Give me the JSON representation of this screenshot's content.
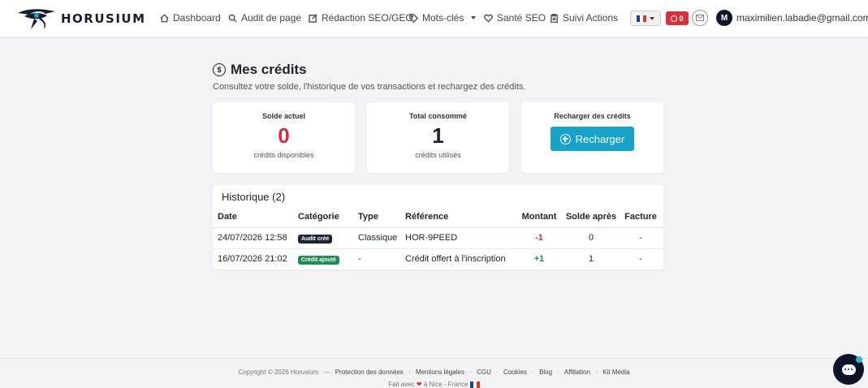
{
  "brand": {
    "name": "HORUSIUM",
    "logo_icon": "horus-eye-logo"
  },
  "nav": {
    "items": [
      {
        "label": "Dashboard",
        "icon": "home-icon"
      },
      {
        "label": "Audit de page",
        "icon": "search-icon"
      },
      {
        "label": "Rédaction SEO/GEO",
        "icon": "edit-icon"
      },
      {
        "label": "Mots-clés",
        "icon": "tag-icon"
      },
      {
        "label": "Santé SEO",
        "icon": "heart-pulse-icon"
      },
      {
        "label": "Suivi Actions",
        "icon": "clipboard-icon"
      }
    ],
    "credits_count": "0",
    "user_initial": "M",
    "user_email": "maximilien.labadie@gmail.com"
  },
  "page": {
    "title": "Mes crédits",
    "subtitle": "Consultez votre solde, l'historique de vos transactions et rechargez des crédits."
  },
  "cards": {
    "balance": {
      "label": "Solde actuel",
      "value": "0",
      "desc": "crédits disponibles"
    },
    "consumed": {
      "label": "Total consommé",
      "value": "1",
      "desc": "crédits utilisés"
    },
    "recharge": {
      "label": "Recharger des crédits",
      "button": "Recharger"
    }
  },
  "history": {
    "title": "Historique (2)",
    "columns": [
      "Date",
      "Catégorie",
      "Type",
      "Référence",
      "Montant",
      "Solde après",
      "Facture"
    ],
    "rows": [
      {
        "date": "24/07/2026 12:58",
        "category": "Audit créé",
        "type": "Classique",
        "reference": "HOR-9PEED",
        "amount": "-1",
        "balance_after": "0",
        "invoice": "-"
      },
      {
        "date": "16/07/2026 21:02",
        "category": "Crédit ajouté",
        "type": "-",
        "reference": "Crédit offert à l'inscription",
        "amount": "+1",
        "balance_after": "1",
        "invoice": "-"
      }
    ]
  },
  "footer": {
    "copyright": "Copyright © 2026 Horusium",
    "links": [
      "Protection des données",
      "Mentions légales",
      "CGU",
      "Cookies",
      "Blog",
      "Affiliation",
      "Kit Média"
    ],
    "made_prefix": "Fait avec",
    "made_suffix": "à Nice - France"
  },
  "colors": {
    "accent": "#17a2c8",
    "danger": "#d02f3b",
    "success": "#1e8c55",
    "dark": "#1b2334"
  }
}
